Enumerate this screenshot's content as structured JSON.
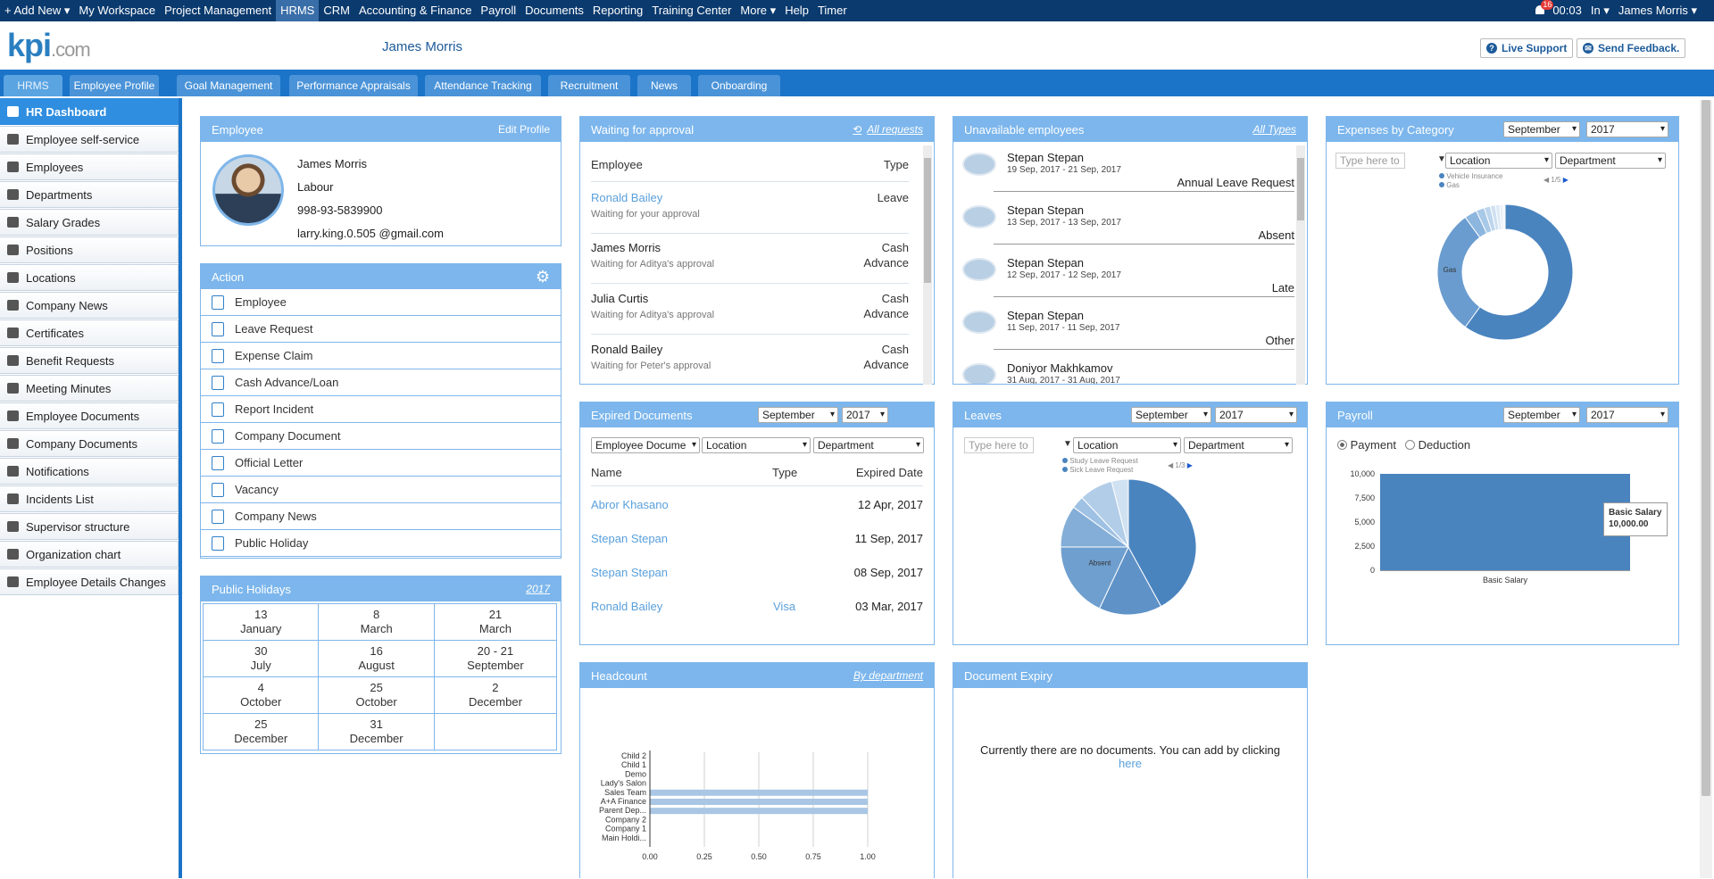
{
  "topnav": {
    "items": [
      "+ Add New ▾",
      "My Workspace",
      "Project Management",
      "HRMS",
      "CRM",
      "Accounting & Finance",
      "Payroll",
      "Documents",
      "Reporting",
      "Training Center",
      "More ▾",
      "Help",
      "Timer"
    ],
    "notif_count": "16",
    "time": "00:03",
    "status": "In ▾",
    "user": "James Morris ▾"
  },
  "header": {
    "logo_main": "kpi",
    "logo_suffix": ".com",
    "username": "James Morris",
    "live_support": "Live Support",
    "send_feedback": "Send Feedback."
  },
  "tabs": [
    "HRMS",
    "Employee Profile",
    "Goal Management",
    "Performance Appraisals",
    "Attendance Tracking",
    "Recruitment",
    "News",
    "Onboarding"
  ],
  "sidebar": [
    "HR Dashboard",
    "Employee self-service",
    "Employees",
    "Departments",
    "Salary Grades",
    "Positions",
    "Locations",
    "Company News",
    "Certificates",
    "Benefit Requests",
    "Meeting Minutes",
    "Employee Documents",
    "Company Documents",
    "Notifications",
    "Incidents List",
    "Supervisor structure",
    "Organization chart",
    "Employee Details Changes"
  ],
  "employee": {
    "title": "Employee",
    "edit": "Edit Profile",
    "name": "James Morris",
    "position": "Labour",
    "phone": "998-93-5839900",
    "email": "larry.king.0.505 @gmail.com"
  },
  "action": {
    "title": "Action",
    "items": [
      "Employee",
      "Leave Request",
      "Expense Claim",
      "Cash Advance/Loan",
      "Report Incident",
      "Company Document",
      "Official Letter",
      "Vacancy",
      "Company News",
      "Public Holiday"
    ]
  },
  "holidays": {
    "title": "Public Holidays",
    "year": "2017",
    "rows": [
      [
        [
          "13",
          "January"
        ],
        [
          "8",
          "March"
        ],
        [
          "21",
          "March"
        ]
      ],
      [
        [
          "30",
          "July"
        ],
        [
          "16",
          "August"
        ],
        [
          "20 - 21",
          "September"
        ]
      ],
      [
        [
          "4",
          "October"
        ],
        [
          "25",
          "October"
        ],
        [
          "2",
          "December"
        ]
      ],
      [
        [
          "25",
          "December"
        ],
        [
          "31",
          "December"
        ],
        [
          "",
          ""
        ]
      ]
    ]
  },
  "approval": {
    "title": "Waiting for approval",
    "all": "All requests",
    "col_employee": "Employee",
    "col_type": "Type",
    "rows": [
      {
        "name": "Ronald Bailey",
        "sub": "Waiting for your approval",
        "type1": "Leave",
        "type2": ""
      },
      {
        "name": "James Morris",
        "sub": "Waiting for Aditya's approval",
        "type1": "Cash",
        "type2": "Advance"
      },
      {
        "name": "Julia Curtis",
        "sub": "Waiting for Aditya's approval",
        "type1": "Cash",
        "type2": "Advance"
      },
      {
        "name": "Ronald Bailey",
        "sub": "Waiting for Peter's approval",
        "type1": "Cash",
        "type2": "Advance"
      }
    ]
  },
  "unavailable": {
    "title": "Unavailable employees",
    "all": "All Types",
    "rows": [
      {
        "name": "Stepan Stepan",
        "dates": "19 Sep, 2017 - 21 Sep, 2017",
        "type": "Annual Leave Request"
      },
      {
        "name": "Stepan Stepan",
        "dates": "13 Sep, 2017 - 13 Sep, 2017",
        "type": "Absent"
      },
      {
        "name": "Stepan Stepan",
        "dates": "12 Sep, 2017 - 12 Sep, 2017",
        "type": "Late"
      },
      {
        "name": "Stepan Stepan",
        "dates": "11 Sep, 2017 - 11 Sep, 2017",
        "type": "Other"
      },
      {
        "name": "Doniyor Makhkamov",
        "dates": "31 Aug, 2017 - 31 Aug, 2017",
        "type": ""
      }
    ]
  },
  "expenses": {
    "title": "Expenses by Category",
    "month": "September",
    "year": "2017",
    "filter_placeholder": "Type here to",
    "location": "Location",
    "department": "Department",
    "legend": [
      "Vehicle Insurance",
      "Gas"
    ],
    "pager": "1/5",
    "slice_label": "Gas"
  },
  "expired": {
    "title": "Expired Documents",
    "month": "September",
    "year": "2017",
    "filter1": "Employee Docume",
    "filter2": "Location",
    "filter3": "Department",
    "col_name": "Name",
    "col_type": "Type",
    "col_date": "Expired Date",
    "rows": [
      {
        "name": "Abror Khasano",
        "type": "",
        "date": "12 Apr, 2017"
      },
      {
        "name": "Stepan Stepan",
        "type": "",
        "date": "11 Sep, 2017"
      },
      {
        "name": "Stepan Stepan",
        "type": "",
        "date": "08 Sep, 2017"
      },
      {
        "name": "Ronald Bailey",
        "type": "Visa",
        "date": "03 Mar, 2017"
      }
    ]
  },
  "leaves": {
    "title": "Leaves",
    "month": "September",
    "year": "2017",
    "filter_placeholder": "Type here to",
    "location": "Location",
    "department": "Department",
    "legend": [
      "Study Leave Request",
      "Sick Leave Request"
    ],
    "pager": "1/3",
    "slice_label": "Absent"
  },
  "payroll": {
    "title": "Payroll",
    "month": "September",
    "year": "2017",
    "opt_payment": "Payment",
    "opt_deduction": "Deduction",
    "tooltip_label": "Basic Salary",
    "tooltip_value": "10,000.00"
  },
  "headcount": {
    "title": "Headcount",
    "by": "By department"
  },
  "docexpiry": {
    "title": "Document Expiry",
    "message": "Currently there are no documents. You can add by clicking",
    "link": "here"
  },
  "chart_data": [
    {
      "type": "bar",
      "name": "payroll",
      "categories": [
        "Basic Salary"
      ],
      "values": [
        10000
      ],
      "ylim": [
        0,
        10000
      ],
      "yticks": [
        "10,000",
        "7,500",
        "5,000",
        "2,500",
        "0"
      ],
      "color": "#4a84bf"
    },
    {
      "type": "bar",
      "orientation": "horizontal",
      "name": "headcount",
      "categories": [
        "Child 2",
        "Child 1",
        "Demo",
        "Lady's Salon",
        "Sales Team",
        "A+A Finance",
        "Parent Dep...",
        "Company 2",
        "Company 1",
        "Main Holdi..."
      ],
      "values": [
        0,
        0,
        0,
        0,
        1,
        1,
        1,
        0,
        0,
        0
      ],
      "xlim": [
        0,
        1
      ],
      "xticks": [
        "0.00",
        "0.25",
        "0.50",
        "0.75",
        "1.00"
      ],
      "color": "#a9c6e4"
    },
    {
      "type": "pie",
      "name": "expenses",
      "donut": true,
      "values": [
        60,
        30,
        3,
        2,
        1.5,
        1.2,
        1,
        0.8,
        0.5
      ],
      "colors": [
        "#4a84bf",
        "#6a9ccf",
        "#8db6df",
        "#a9c9e8",
        "#bcd5ed",
        "#cfe0f1",
        "#dce9f5",
        "#e7eff8",
        "#f0f5fb"
      ]
    },
    {
      "type": "pie",
      "name": "leaves",
      "values": [
        42,
        15,
        18,
        10,
        3,
        8,
        4
      ],
      "colors": [
        "#4a84bf",
        "#5f92c7",
        "#6f9fcf",
        "#84aed8",
        "#9fc1e3",
        "#b2cde8",
        "#d0e1f1"
      ]
    }
  ]
}
